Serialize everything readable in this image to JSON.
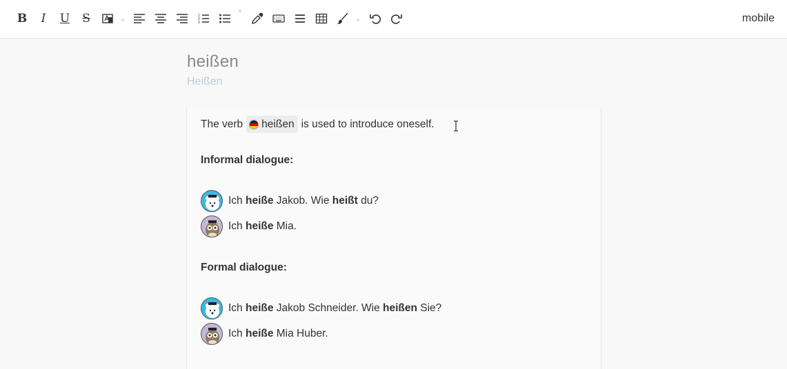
{
  "toolbar": {
    "mobile_label": "mobile",
    "bold_label": "B",
    "italic_label": "I",
    "underline_label": "U",
    "strike_label": "S"
  },
  "page": {
    "title": "heißen",
    "subtitle": "Heißen"
  },
  "content": {
    "intro_prefix": "The verb",
    "intro_chip": "heißen",
    "intro_suffix": "is used to introduce oneself.",
    "informal_heading": "Informal dialogue:",
    "informal": [
      {
        "parts": [
          [
            "Ich ",
            false
          ],
          [
            "heiße",
            true
          ],
          [
            " Jakob. Wie ",
            false
          ],
          [
            "heißt",
            true
          ],
          [
            " du?",
            false
          ]
        ]
      },
      {
        "parts": [
          [
            "Ich ",
            false
          ],
          [
            "heiße",
            true
          ],
          [
            " Mia.",
            false
          ]
        ]
      }
    ],
    "formal_heading": "Formal dialogue:",
    "formal": [
      {
        "parts": [
          [
            "Ich ",
            false
          ],
          [
            "heiße",
            true
          ],
          [
            " Jakob Schneider. Wie ",
            false
          ],
          [
            "heißen",
            true
          ],
          [
            " Sie?",
            false
          ]
        ]
      },
      {
        "parts": [
          [
            "Ich ",
            false
          ],
          [
            "heiße",
            true
          ],
          [
            " Mia Huber.",
            false
          ]
        ]
      }
    ]
  },
  "icons": {
    "bold": "bold-icon",
    "italic": "italic-icon",
    "underline": "underline-icon",
    "strike": "strikethrough-icon",
    "translate": "translate-icon",
    "align_left": "align-left-icon",
    "align_center": "align-center-icon",
    "align_right": "align-right-icon",
    "ordered_list": "ordered-list-icon",
    "bullet_list": "bullet-list-icon",
    "eyedropper": "eyedropper-icon",
    "keyboard": "keyboard-icon",
    "menu": "menu-icon",
    "table": "table-icon",
    "brush": "brush-icon",
    "undo": "undo-icon",
    "redo": "redo-icon"
  },
  "colors": {
    "bear_avatar": "#3db9e0",
    "owl_avatar": "#c4b8d8",
    "subtitle": "#b9cfda"
  }
}
